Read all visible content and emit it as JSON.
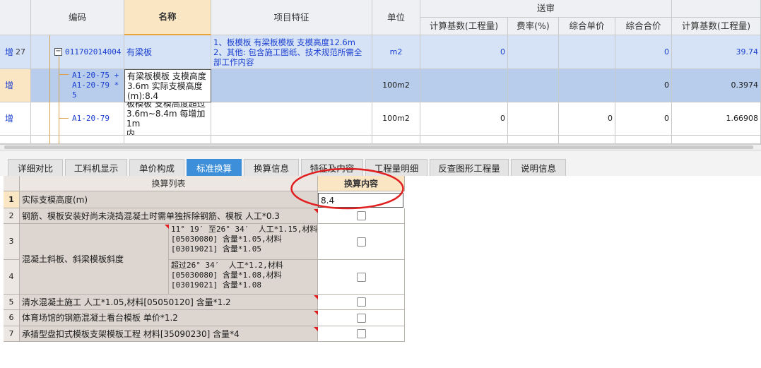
{
  "top_table": {
    "headers": {
      "code": "编码",
      "name": "名称",
      "feature": "项目特征",
      "unit": "单位",
      "review_group": "送审",
      "calc_base": "计算基数(工程量)",
      "rate": "费率(%)",
      "unit_price": "综合单价",
      "total_price": "综合合价",
      "calc_base2": "计算基数(工程量)"
    },
    "rows": [
      {
        "flag": "增",
        "index": "27",
        "code": "011702014004",
        "name": "有梁板",
        "feature_line1": "1、板模板 有梁板模板 支模高度12.6m",
        "feature_line2": "2、其他: 包含施工图纸、技术规范所需全",
        "feature_line3": "部工作内容",
        "unit": "m2",
        "calc_base": "0",
        "total_price": "0",
        "calc_base2": "39.74"
      },
      {
        "flag": "增",
        "code_line1": "A1-20-75 +",
        "code_line2": "A1-20-79 *",
        "code_line3": "5",
        "name_line1": "有梁板模板 支模高度",
        "name_line2": "3.6m  实际支模高度",
        "name_line3": "(m):8.4",
        "unit": "100m2",
        "total_price": "0",
        "calc_base2": "0.3974"
      },
      {
        "flag": "增",
        "code": "A1-20-79",
        "name_line1": "板模板 支模高度超过",
        "name_line2": "3.6m~8.4m 每增加1m",
        "name_line3": "内",
        "unit": "100m2",
        "calc_base": "0",
        "unit_price": "0",
        "total_price": "0",
        "calc_base2": "1.66908"
      }
    ]
  },
  "tabs": [
    {
      "label": "详细对比"
    },
    {
      "label": "工料机显示"
    },
    {
      "label": "单价构成"
    },
    {
      "label": "标准换算"
    },
    {
      "label": "换算信息"
    },
    {
      "label": "特征及内容"
    },
    {
      "label": "工程量明细"
    },
    {
      "label": "反查图形工程量"
    },
    {
      "label": "说明信息"
    }
  ],
  "active_tab": "标准换算",
  "bottom_table": {
    "headers": {
      "list": "换算列表",
      "content": "换算内容"
    },
    "rows": [
      {
        "num": "1",
        "desc": "实际支模高度(m)",
        "value": "8.4"
      },
      {
        "num": "2",
        "desc": "钢筋、模板安装好尚未浇捣混凝土时需单独拆除钢筋、模板 人工*0.3"
      },
      {
        "num": "3",
        "group": "混凝土斜板、斜梁模板斜度",
        "sub": "11° 19′ 至26° 34′  人工*1.15,材料\n[05030080] 含量*1.05,材料\n[03019021] 含量*1.05"
      },
      {
        "num": "4",
        "sub": "超过26° 34′  人工*1.2,材料\n[05030080] 含量*1.08,材料\n[03019021] 含量*1.08"
      },
      {
        "num": "5",
        "desc": "清水混凝土施工 人工*1.05,材料[05050120] 含量*1.2"
      },
      {
        "num": "6",
        "desc": "体育场馆的钢筋混凝土看台模板 单价*1.2"
      },
      {
        "num": "7",
        "desc": "承插型盘扣式模板支架模板工程 材料[35090230] 含量*4"
      }
    ]
  },
  "colors": {
    "active_tab": "#3d8fd9",
    "selected_header": "#fbe6c4",
    "row_highlight": "#d6e3f6",
    "row_selected": "#b8cdec",
    "annotation": "#e02020",
    "link_text": "#1a3fd0"
  }
}
